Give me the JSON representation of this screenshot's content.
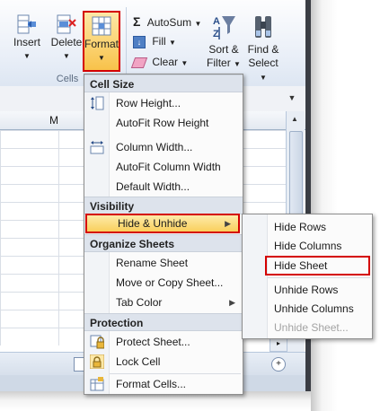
{
  "ribbon": {
    "insert_label": "Insert",
    "delete_label": "Delete",
    "format_label": "Format",
    "cells_group": "Cells",
    "autosum_label": "AutoSum",
    "fill_label": "Fill",
    "clear_label": "Clear",
    "sort_label_1": "Sort &",
    "sort_label_2": "Filter",
    "find_label_1": "Find &",
    "find_label_2": "Select"
  },
  "sheet": {
    "column_m": "M"
  },
  "format_menu": {
    "cell_size_header": "Cell Size",
    "row_height": "Row Height...",
    "autofit_row": "AutoFit Row Height",
    "column_width": "Column Width...",
    "autofit_column": "AutoFit Column Width",
    "default_width": "Default Width...",
    "visibility_header": "Visibility",
    "hide_unhide": "Hide & Unhide",
    "organize_header": "Organize Sheets",
    "rename_sheet": "Rename Sheet",
    "move_copy": "Move or Copy Sheet...",
    "tab_color": "Tab Color",
    "protection_header": "Protection",
    "protect_sheet": "Protect Sheet...",
    "lock_cell": "Lock Cell",
    "format_cells": "Format Cells..."
  },
  "submenu": {
    "hide_rows": "Hide Rows",
    "hide_columns": "Hide Columns",
    "hide_sheet": "Hide Sheet",
    "unhide_rows": "Unhide Rows",
    "unhide_columns": "Unhide Columns",
    "unhide_sheet": "Unhide Sheet..."
  },
  "icons": [
    "insert-cells-icon",
    "delete-cells-icon",
    "format-icon",
    "autosum-icon",
    "fill-icon",
    "clear-icon",
    "sort-filter-icon",
    "find-select-icon",
    "row-height-icon",
    "column-width-icon",
    "protect-sheet-icon",
    "lock-cell-icon",
    "format-cells-icon"
  ],
  "colors": {
    "highlight": "#f9cf5c",
    "callout_red": "#d40000"
  }
}
